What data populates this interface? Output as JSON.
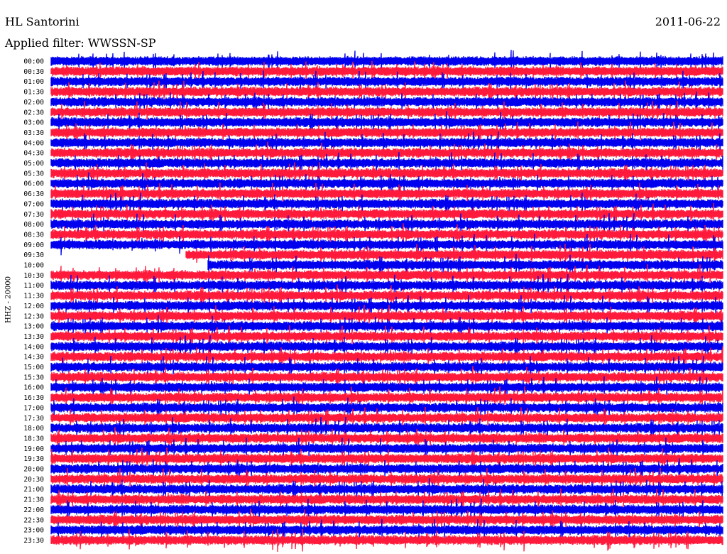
{
  "header": {
    "station": "HL Santorini",
    "date": "2011-06-22",
    "filter": "Applied filter: WWSSN-SP"
  },
  "chart_data": {
    "type": "line",
    "ylabel": "HHZ - 20000",
    "time_labels": [
      "00:00",
      "00:30",
      "01:00",
      "01:30",
      "02:00",
      "02:30",
      "03:00",
      "03:30",
      "04:00",
      "04:30",
      "05:00",
      "05:30",
      "06:00",
      "06:30",
      "07:00",
      "07:30",
      "08:00",
      "08:30",
      "09:00",
      "09:30",
      "10:00",
      "10:30",
      "11:00",
      "11:30",
      "12:00",
      "12:30",
      "13:00",
      "13:30",
      "14:00",
      "14:30",
      "15:00",
      "15:30",
      "16:00",
      "16:30",
      "17:00",
      "17:30",
      "18:00",
      "18:30",
      "19:00",
      "19:30",
      "20:00",
      "20:30",
      "21:00",
      "21:30",
      "22:00",
      "22:30",
      "23:00",
      "23:30"
    ],
    "colors": [
      "#0000ee",
      "#ff1a3c"
    ],
    "row_minutes": 30,
    "data_gaps": [
      {
        "start": "09:30",
        "end": "09:36"
      },
      {
        "start": "10:00",
        "end": "10:07"
      }
    ]
  }
}
